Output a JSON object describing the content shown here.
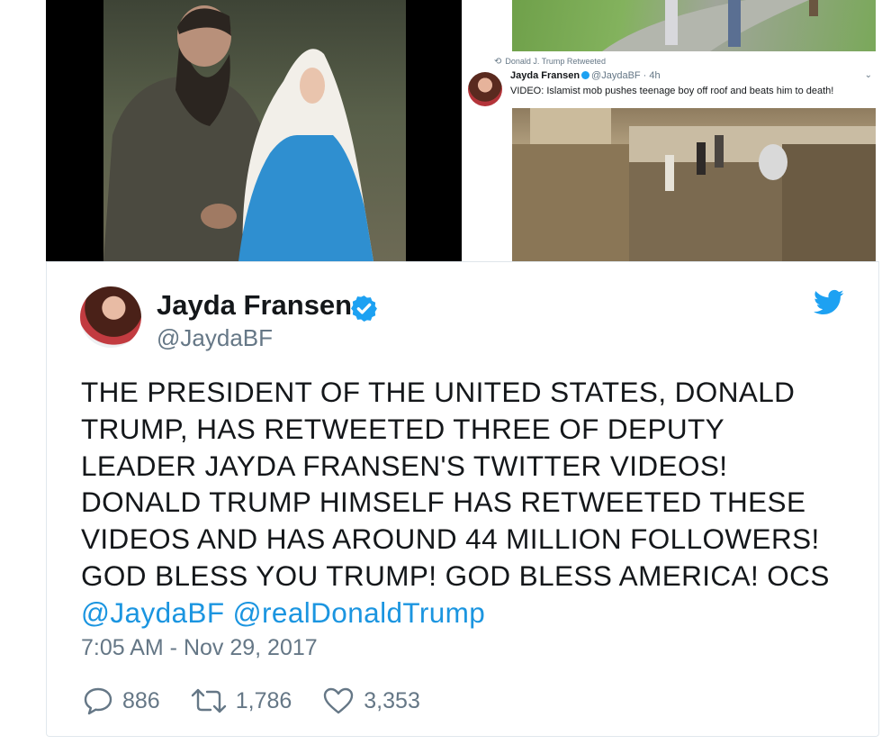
{
  "embed": {
    "retweeted_label": "Donald J. Trump Retweeted",
    "name": "Jayda Fransen",
    "handle": "@JaydaBF",
    "age": "4h",
    "text": "VIDEO: Islamist mob pushes teenage boy off roof and beats him to death!"
  },
  "tweet": {
    "display_name": "Jayda Fransen",
    "handle": "@JaydaBF",
    "text": "THE PRESIDENT OF THE UNITED STATES, DONALD TRUMP, HAS RETWEETED THREE OF DEPUTY LEADER JAYDA FRANSEN'S TWITTER VIDEOS! DONALD TRUMP HIMSELF HAS RETWEETED THESE VIDEOS AND HAS AROUND 44 MILLION FOLLOWERS! GOD BLESS YOU TRUMP! GOD BLESS AMERICA! OCS",
    "mention_1": "@JaydaBF",
    "mention_2": "@realDonaldTrump",
    "timestamp": "7:05 AM - Nov 29, 2017",
    "replies": "886",
    "retweets": "1,786",
    "likes": "3,353"
  },
  "icons": {
    "reply": "reply-icon",
    "retweet": "retweet-icon",
    "like": "like-icon",
    "verified": "verified-icon",
    "brand": "twitter-bird-icon"
  },
  "colors": {
    "accent": "#1da1f2",
    "link": "#1b95e0",
    "text": "#14171a",
    "muted": "#657786"
  }
}
